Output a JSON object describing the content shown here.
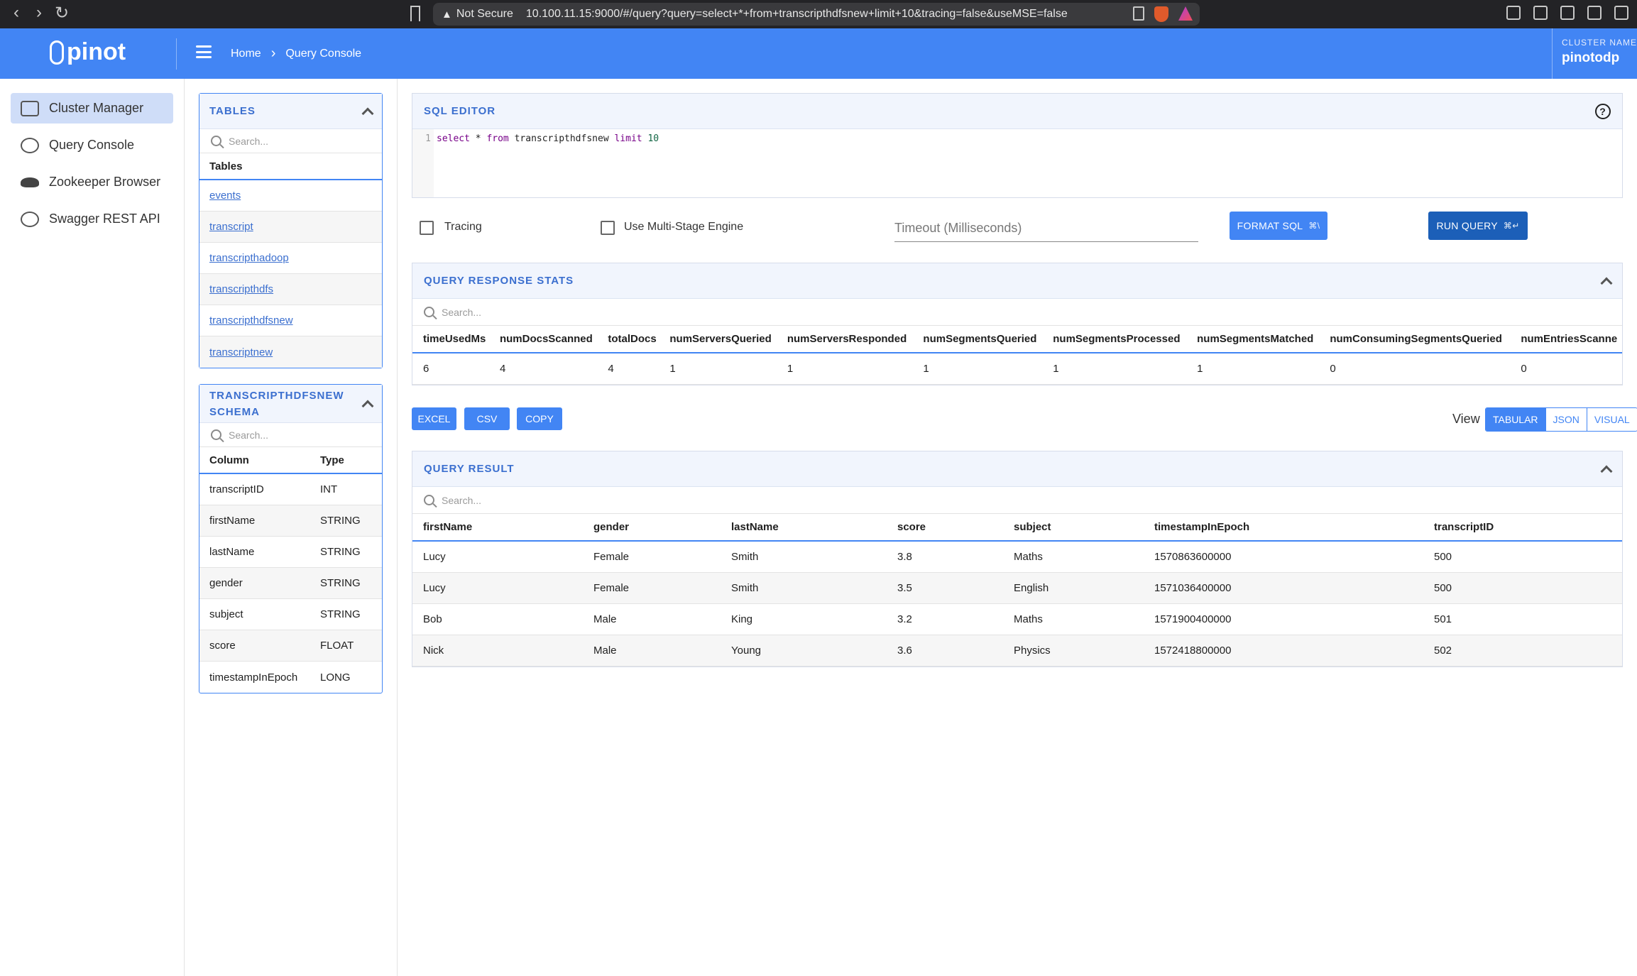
{
  "browser": {
    "security": "Not Secure",
    "url": "10.100.11.15:9000/#/query?query=select+*+from+transcripthdfsnew+limit+10&tracing=false&useMSE=false"
  },
  "header": {
    "logo": "pinot",
    "breadcrumb": [
      "Home",
      "Query Console"
    ],
    "cluster_label": "CLUSTER NAME",
    "cluster_name": "pinotodp"
  },
  "left_nav": {
    "items": [
      {
        "label": "Cluster Manager",
        "icon": "cluster-icon",
        "active": true
      },
      {
        "label": "Query Console",
        "icon": "query-icon",
        "active": false
      },
      {
        "label": "Zookeeper Browser",
        "icon": "zookeeper-icon",
        "active": false
      },
      {
        "label": "Swagger REST API",
        "icon": "api-icon",
        "active": false
      }
    ]
  },
  "tables_panel": {
    "title": "TABLES",
    "search_placeholder": "Search...",
    "column_header": "Tables",
    "tables": [
      "events",
      "transcript",
      "transcripthadoop",
      "transcripthdfs",
      "transcripthdfsnew",
      "transcriptnew"
    ]
  },
  "schema_panel": {
    "title": "TRANSCRIPTHDFSNEW SCHEMA",
    "search_placeholder": "Search...",
    "headers": [
      "Column",
      "Type"
    ],
    "rows": [
      [
        "transcriptID",
        "INT"
      ],
      [
        "firstName",
        "STRING"
      ],
      [
        "lastName",
        "STRING"
      ],
      [
        "gender",
        "STRING"
      ],
      [
        "subject",
        "STRING"
      ],
      [
        "score",
        "FLOAT"
      ],
      [
        "timestampInEpoch",
        "LONG"
      ]
    ]
  },
  "sql_editor": {
    "title": "SQL EDITOR",
    "line_number": "1",
    "query_tokens": {
      "select": "select",
      "star": " * ",
      "from": "from",
      "table": " transcripthdfsnew ",
      "limit": "limit",
      "num": " 10"
    }
  },
  "controls": {
    "tracing_label": "Tracing",
    "mse_label": "Use Multi-Stage Engine",
    "timeout_placeholder": "Timeout (Milliseconds)",
    "format_label": "FORMAT SQL",
    "format_shortcut": "⌘\\",
    "run_label": "RUN QUERY",
    "run_shortcut": "⌘↵"
  },
  "stats": {
    "title": "QUERY RESPONSE STATS",
    "search_placeholder": "Search...",
    "headers": [
      "timeUsedMs",
      "numDocsScanned",
      "totalDocs",
      "numServersQueried",
      "numServersResponded",
      "numSegmentsQueried",
      "numSegmentsProcessed",
      "numSegmentsMatched",
      "numConsumingSegmentsQueried",
      "numEntriesScanne"
    ],
    "values": [
      "6",
      "4",
      "4",
      "1",
      "1",
      "1",
      "1",
      "1",
      "0",
      "0"
    ]
  },
  "export": {
    "excel": "EXCEL",
    "csv": "CSV",
    "copy": "COPY",
    "view_label": "View",
    "views": [
      "TABULAR",
      "JSON",
      "VISUAL"
    ]
  },
  "result": {
    "title": "QUERY RESULT",
    "search_placeholder": "Search...",
    "headers": [
      "firstName",
      "gender",
      "lastName",
      "score",
      "subject",
      "timestampInEpoch",
      "transcriptID"
    ],
    "rows": [
      [
        "Lucy",
        "Female",
        "Smith",
        "3.8",
        "Maths",
        "1570863600000",
        "500"
      ],
      [
        "Lucy",
        "Female",
        "Smith",
        "3.5",
        "English",
        "1571036400000",
        "500"
      ],
      [
        "Bob",
        "Male",
        "King",
        "3.2",
        "Maths",
        "1571900400000",
        "501"
      ],
      [
        "Nick",
        "Male",
        "Young",
        "3.6",
        "Physics",
        "1572418800000",
        "502"
      ]
    ]
  },
  "colors": {
    "brand": "#4285f4",
    "run_button": "#1c5fb8",
    "nav_active": "#cfddf8"
  }
}
